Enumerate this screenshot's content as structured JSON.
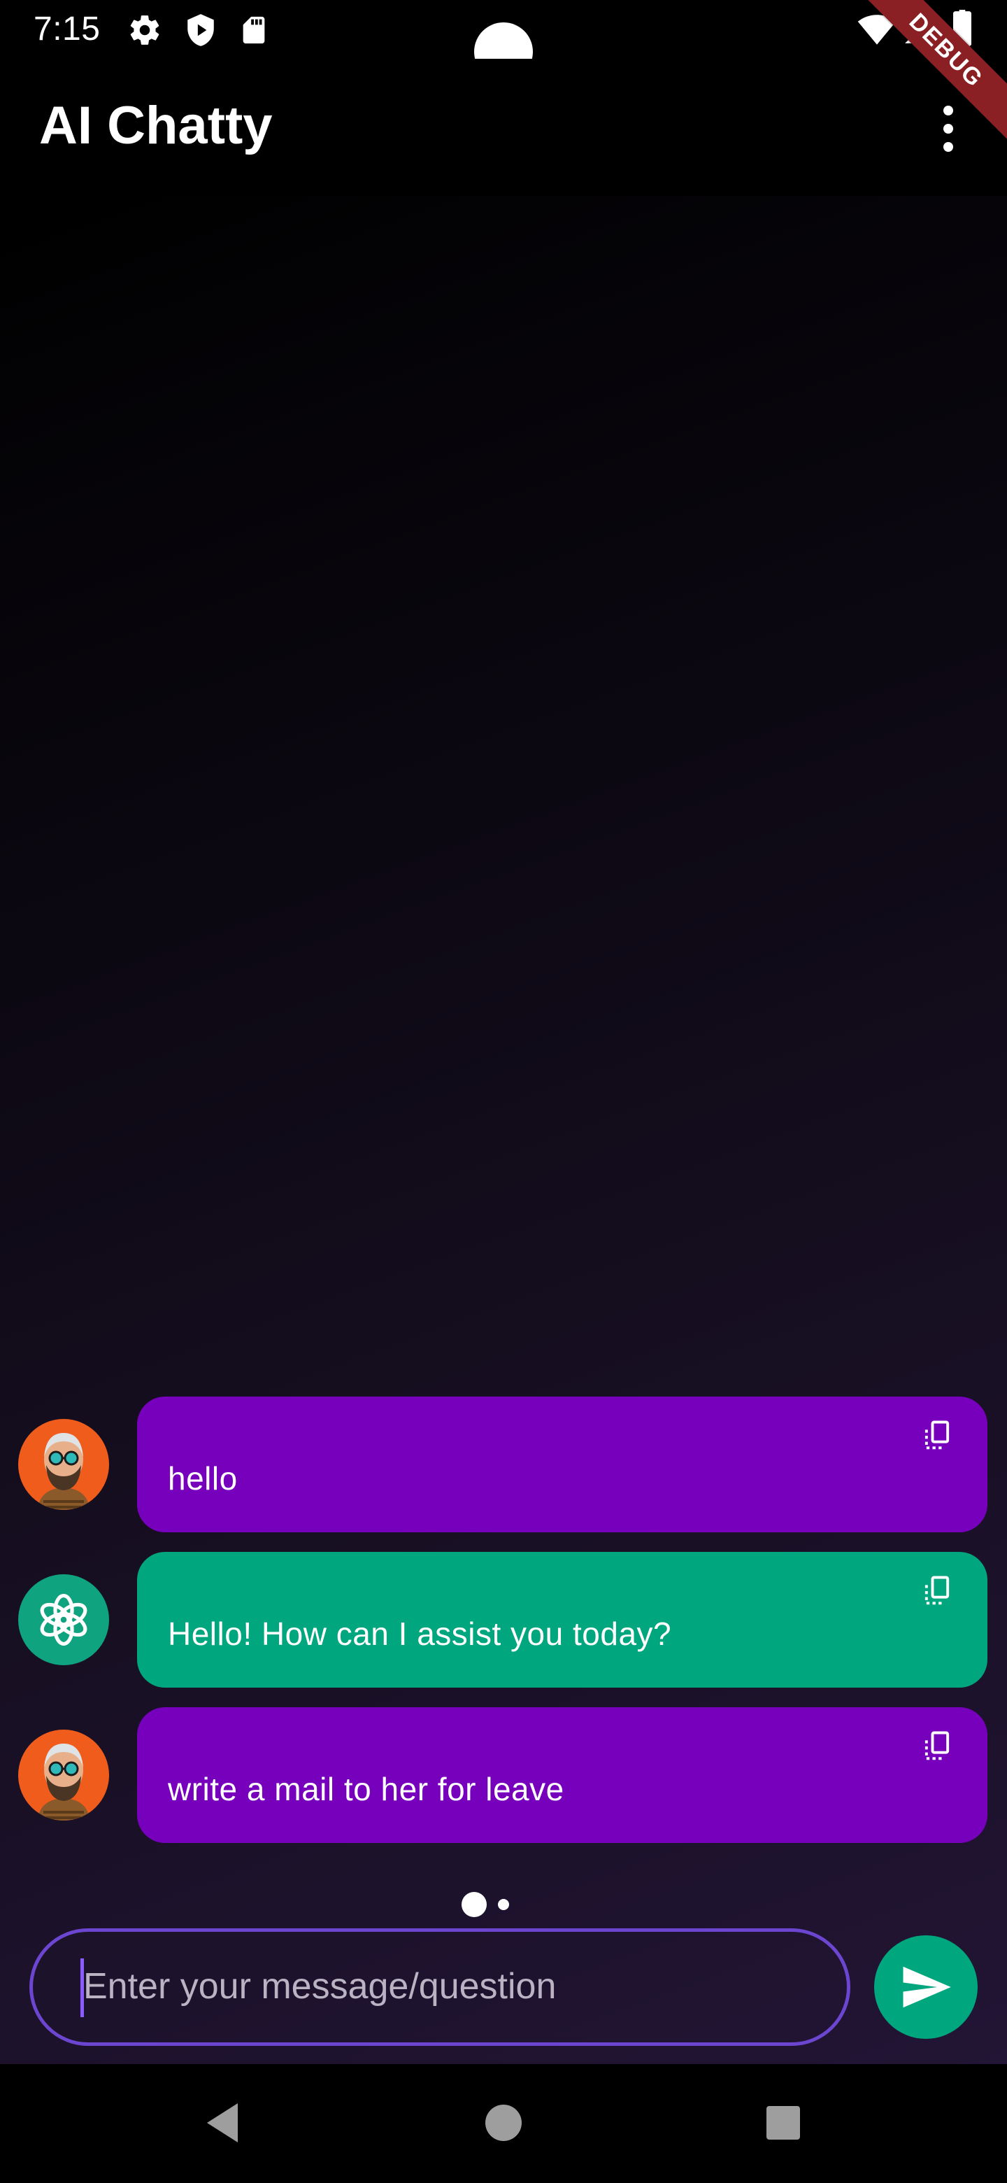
{
  "status_bar": {
    "time": "7:15",
    "icons": [
      "gear-icon",
      "play-protect-icon",
      "sd-card-icon",
      "wifi-icon",
      "signal-icon",
      "battery-icon"
    ]
  },
  "debug_banner": "DEBUG",
  "app_bar": {
    "title": "AI Chatty",
    "menu_icon": "more-vert-icon"
  },
  "messages": [
    {
      "role": "user",
      "text": "hello",
      "avatar": "user-avatar",
      "copy_icon": "copy-icon"
    },
    {
      "role": "assistant",
      "text": "Hello! How can I assist you today?",
      "avatar": "openai-logo-icon",
      "copy_icon": "copy-icon"
    },
    {
      "role": "user",
      "text": "write a mail to her for leave",
      "avatar": "user-avatar",
      "copy_icon": "copy-icon"
    }
  ],
  "page_indicator": {
    "pages": 2,
    "active_index": 0
  },
  "composer": {
    "placeholder": "Enter your message/question",
    "send_icon": "send-icon"
  },
  "nav_bar": {
    "buttons": [
      "back-icon",
      "home-icon",
      "recents-icon"
    ]
  },
  "colors": {
    "user_bubble": "#7700bd",
    "assistant_bubble": "#00a67e",
    "input_border": "#6c46d0",
    "user_avatar_bg": "#ef5c1b"
  }
}
